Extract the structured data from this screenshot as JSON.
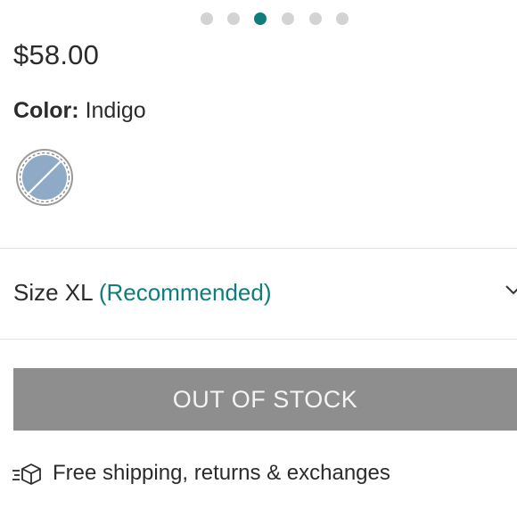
{
  "carousel": {
    "count": 6,
    "active_index": 2,
    "accent": "#0f7d78",
    "inactive": "#d3d3d3"
  },
  "product": {
    "price": "$58.00",
    "color_label": "Color:",
    "color_value": "Indigo",
    "swatch": {
      "name": "Indigo",
      "color": "#8eaac6",
      "state": "unavailable"
    }
  },
  "size": {
    "prefix": "Size XL",
    "recommended": "(Recommended)",
    "icon": "chevron-down-icon"
  },
  "buy_button": {
    "label": "OUT OF STOCK",
    "state": "disabled",
    "color": "#8e8e8e"
  },
  "shipping": {
    "icon": "box-icon",
    "text": "Free shipping, returns & exchanges"
  }
}
